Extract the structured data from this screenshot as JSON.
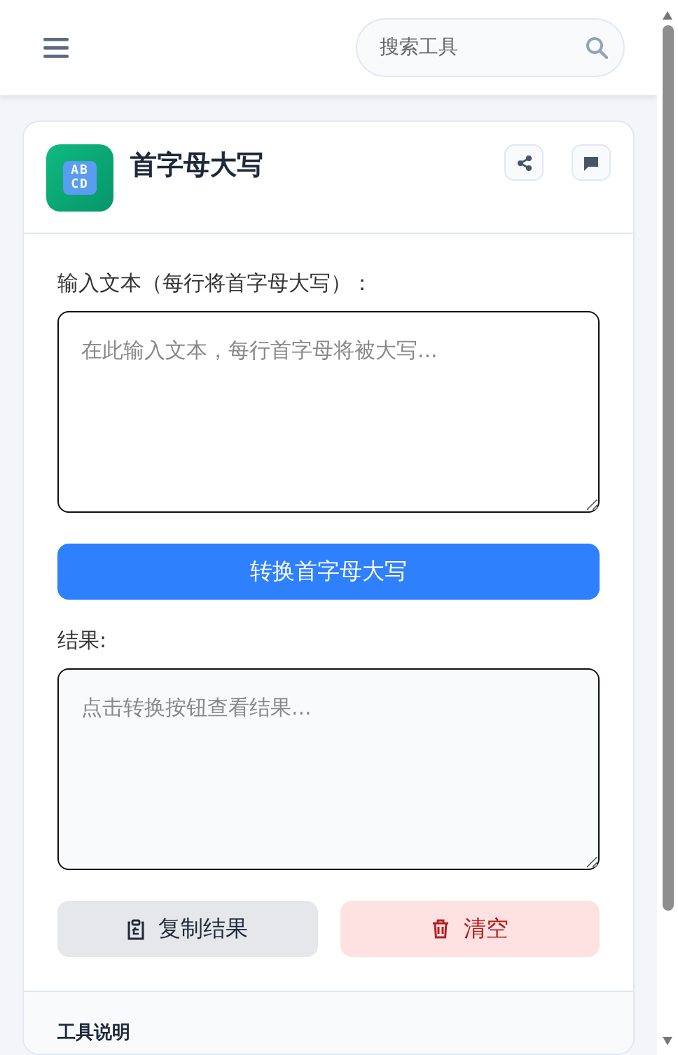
{
  "header": {
    "search": {
      "placeholder": "搜索工具"
    }
  },
  "tool": {
    "icon_glyphs": [
      "AB",
      "CD"
    ],
    "title": "首字母大写",
    "input": {
      "label": "输入文本（每行将首字母大写）：",
      "placeholder": "在此输入文本，每行首字母将被大写..."
    },
    "convert_button": "转换首字母大写",
    "result": {
      "label": "结果:",
      "placeholder": "点击转换按钮查看结果..."
    },
    "actions": [
      {
        "kind": "copy",
        "label": "复制结果"
      },
      {
        "kind": "clear",
        "label": "清空"
      }
    ],
    "footer_title": "工具说明"
  }
}
